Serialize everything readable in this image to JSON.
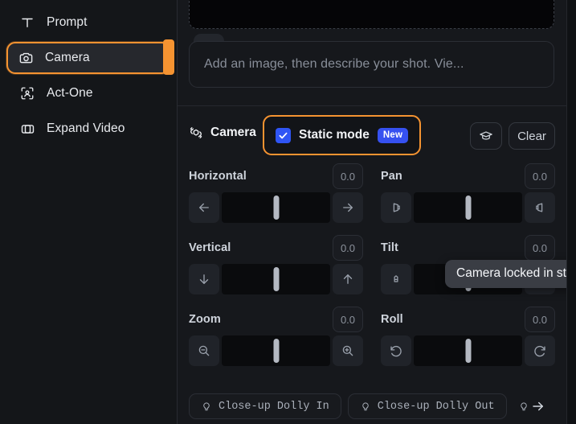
{
  "sidebar": {
    "items": [
      {
        "label": "Prompt",
        "icon": "text-t-icon",
        "selected": false
      },
      {
        "label": "Camera",
        "icon": "camera-icon",
        "selected": true
      },
      {
        "label": "Act-One",
        "icon": "face-scan-icon",
        "selected": false
      },
      {
        "label": "Expand Video",
        "icon": "expand-video-icon",
        "selected": false
      }
    ]
  },
  "upload": {
    "attach_icon": "paperclip-icon"
  },
  "prompt": {
    "placeholder": "Add an image, then describe your shot. Vie..."
  },
  "camera_header": {
    "title": "Camera",
    "title_icon": "camera-orbit-icon",
    "static_mode_label": "Static mode",
    "static_mode_checked": true,
    "static_mode_badge": "New",
    "learn_icon": "graduation-cap-icon",
    "clear_label": "Clear"
  },
  "tooltip": {
    "text": "Camera locked in static mode."
  },
  "controls": [
    {
      "name": "Horizontal",
      "value": "0.0",
      "position": 50,
      "dec_icon": "arrow-left-icon",
      "inc_icon": "arrow-right-icon"
    },
    {
      "name": "Pan",
      "value": "0.0",
      "position": 50,
      "dec_icon": "pan-left-icon",
      "inc_icon": "pan-right-icon"
    },
    {
      "name": "Vertical",
      "value": "0.0",
      "position": 50,
      "dec_icon": "arrow-down-icon",
      "inc_icon": "arrow-up-icon"
    },
    {
      "name": "Tilt",
      "value": "0.0",
      "position": 50,
      "dec_icon": "tilt-up-icon",
      "inc_icon": "tilt-down-icon"
    },
    {
      "name": "Zoom",
      "value": "0.0",
      "position": 50,
      "dec_icon": "zoom-out-icon",
      "inc_icon": "zoom-in-icon"
    },
    {
      "name": "Roll",
      "value": "0.0",
      "position": 50,
      "dec_icon": "rotate-ccw-icon",
      "inc_icon": "rotate-cw-icon"
    }
  ],
  "presets": [
    {
      "label": "Close-up Dolly In",
      "icon": "lightbulb-icon"
    },
    {
      "label": "Close-up Dolly Out",
      "icon": "lightbulb-icon"
    }
  ],
  "presets_next_icon": "arrow-right-icon",
  "colors": {
    "accent_orange": "#f59331",
    "checkbox_blue": "#2f55f5",
    "badge_blue": "#3651f0",
    "panel_bg": "#16181c",
    "sidebar_bg": "#141619",
    "track_bg": "#0a0b0d",
    "thumb": "#b4b9c2",
    "tooltip_bg": "#3a3d44"
  }
}
